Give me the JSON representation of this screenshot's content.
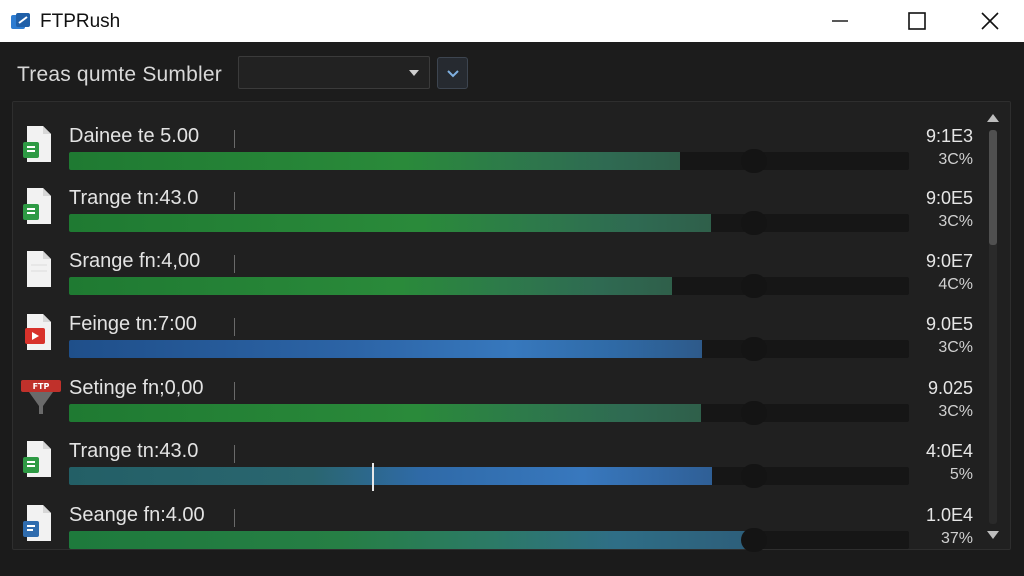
{
  "window": {
    "title": "FTPRush",
    "controls": {
      "minimize_icon": "minimize-icon",
      "maximize_icon": "maximize-icon",
      "close_icon": "close-icon"
    }
  },
  "toolbar": {
    "label": "Treas qumte Sumbler",
    "select_value": "",
    "dropdown_icon": "chevron-down-icon"
  },
  "transfers": [
    {
      "name": "Dainee te 5.00",
      "value": "9:1E3",
      "percent_label": "3C%",
      "icon": "spreadsheet-file-icon",
      "progress": 0.727,
      "color": "green"
    },
    {
      "name": "Trange tn:43.0",
      "value": "9:0E5",
      "percent_label": "3C%",
      "icon": "spreadsheet-file-icon",
      "progress": 0.764,
      "color": "green"
    },
    {
      "name": "Srange fn:4,00",
      "value": "9:0E7",
      "percent_label": "4C%",
      "icon": "blank-file-icon",
      "progress": 0.718,
      "color": "green"
    },
    {
      "name": "Feinge tn:7:00",
      "value": "9.0E5",
      "percent_label": "3C%",
      "icon": "pdf-file-icon",
      "progress": 0.754,
      "color": "blue"
    },
    {
      "name": "Setinge fn;0,00",
      "value": "9.025",
      "percent_label": "3C%",
      "icon": "ftp-logo-icon",
      "progress": 0.752,
      "color": "green"
    },
    {
      "name": "Trange tn:43.0",
      "value": "4:0E4",
      "percent_label": "5%",
      "icon": "spreadsheet-file-icon",
      "progress": 0.765,
      "color": "mixed"
    },
    {
      "name": "Seange fn:4.00",
      "value": "1.0E4",
      "percent_label": "37%",
      "icon": "document-file-icon",
      "progress": 0.812,
      "color": "green-blue"
    }
  ],
  "scrollbar": {
    "up_icon": "scroll-up-icon",
    "down_icon": "scroll-down-icon"
  },
  "colors": {
    "green": "#2c8a3c",
    "blue": "#2f6cae",
    "teal": "#2e6e6c",
    "background": "#1b1b1b"
  }
}
